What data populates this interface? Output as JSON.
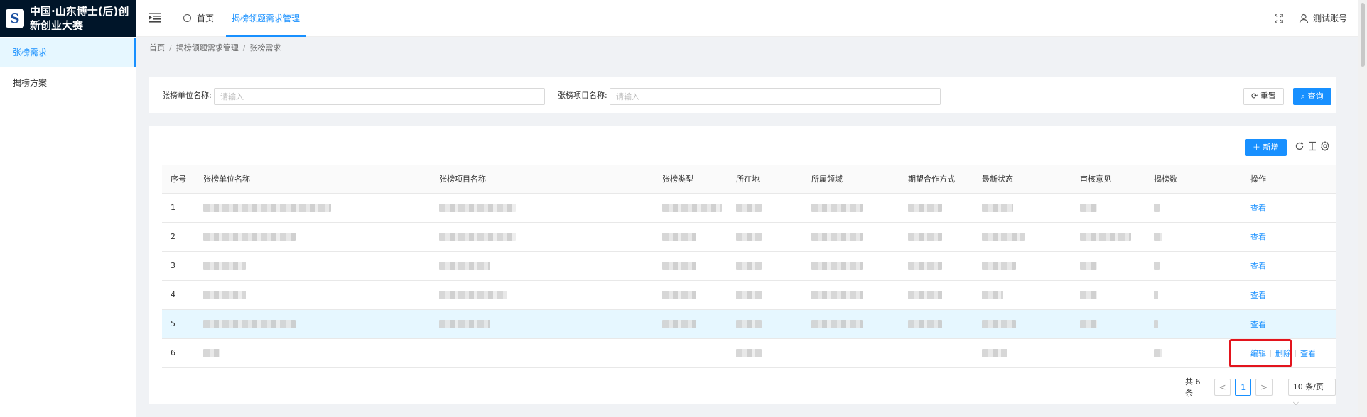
{
  "app": {
    "logo_glyph": "S",
    "title_line1": "中国·山东博士(后)创",
    "title_line2": "新创业大赛"
  },
  "sidebar": {
    "items": [
      {
        "label": "张榜需求",
        "active": true
      },
      {
        "label": "揭榜方案",
        "active": false
      }
    ]
  },
  "header": {
    "home_tab": "首页",
    "active_tab": "揭榜领题需求管理",
    "user_name": "测试账号"
  },
  "breadcrumb": [
    "首页",
    "揭榜领题需求管理",
    "张榜需求"
  ],
  "search": {
    "field1_label": "张榜单位名称:",
    "field1_placeholder": "请输入",
    "field2_label": "张榜项目名称:",
    "field2_placeholder": "请输入",
    "reset_label": "重置",
    "query_label": "查询"
  },
  "toolbar": {
    "add_label": "新增"
  },
  "table": {
    "columns": [
      "序号",
      "张榜单位名称",
      "张榜项目名称",
      "张榜类型",
      "所在地",
      "所属领域",
      "期望合作方式",
      "最新状态",
      "审核意见",
      "揭榜数",
      "操作"
    ],
    "rows": [
      {
        "index": "1",
        "actions": [
          "查看"
        ]
      },
      {
        "index": "2",
        "actions": [
          "查看"
        ]
      },
      {
        "index": "3",
        "actions": [
          "查看"
        ]
      },
      {
        "index": "4",
        "actions": [
          "查看"
        ]
      },
      {
        "index": "5",
        "actions": [
          "查看"
        ],
        "highlighted": true
      },
      {
        "index": "6",
        "actions": [
          "编辑",
          "删除",
          "查看"
        ]
      }
    ]
  },
  "pagination": {
    "total_text": "共 6 条",
    "current_page": "1",
    "prev_glyph": "<",
    "next_glyph": ">",
    "page_size": "10 条/页"
  },
  "colors": {
    "primary": "#1890ff",
    "sidebar_header": "#001529",
    "highlight_row": "#e6f7ff",
    "annotation": "#e3141d"
  }
}
